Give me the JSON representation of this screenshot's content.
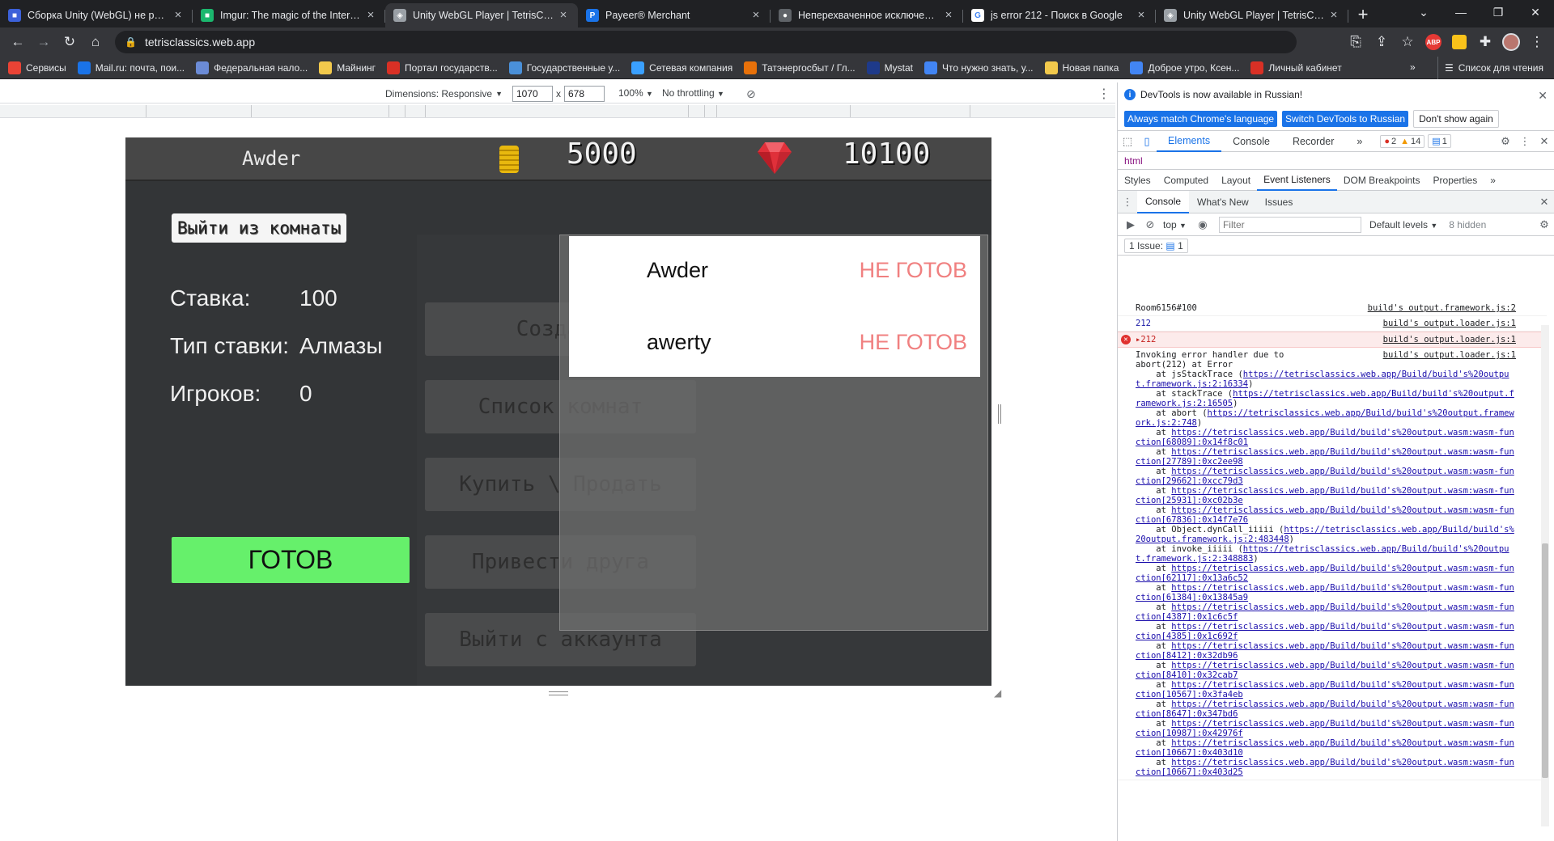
{
  "browser": {
    "tabs": [
      {
        "title": "Сборка Unity (WebGL) не рабо…",
        "color": "#3c61d9",
        "active": false,
        "glyph": "■"
      },
      {
        "title": "Imgur: The magic of the Internet",
        "color": "#1bb76e",
        "active": false,
        "glyph": "■"
      },
      {
        "title": "Unity WebGL Player | TetrisClass",
        "color": "#9aa0a6",
        "active": true,
        "glyph": "◈"
      },
      {
        "title": "Payeer® Merchant",
        "color": "#1a73e8",
        "active": false,
        "glyph": "P"
      },
      {
        "title": "Неперехваченное исключение",
        "color": "#5f6368",
        "active": false,
        "glyph": "●"
      },
      {
        "title": "js error 212 - Поиск в Google",
        "color": "#ffffff",
        "active": false,
        "glyph": "G"
      },
      {
        "title": "Unity WebGL Player | TetrisClass",
        "color": "#9aa0a6",
        "active": false,
        "glyph": "◈"
      }
    ],
    "url": "tetrisclassics.web.app",
    "bookmarks": [
      {
        "label": "Сервисы",
        "color": "#ea4335"
      },
      {
        "label": "Mail.ru: почта, пои...",
        "color": "#1a73e8"
      },
      {
        "label": "Федеральная нало...",
        "color": "#6b8bd6"
      },
      {
        "label": "Майнинг",
        "color": "#f2c94c"
      },
      {
        "label": "Портал государств...",
        "color": "#d93025"
      },
      {
        "label": "Государственные у...",
        "color": "#4a90d9"
      },
      {
        "label": "Сетевая компания",
        "color": "#3aa0ff"
      },
      {
        "label": "Татэнергосбыт / Гл...",
        "color": "#e8710a"
      },
      {
        "label": "Mystat",
        "color": "#1e3a8a"
      },
      {
        "label": "Что нужно знать, у...",
        "color": "#4285f4"
      },
      {
        "label": "Новая папка",
        "color": "#f2c94c"
      },
      {
        "label": "Доброе утро, Ксен...",
        "color": "#4285f4"
      },
      {
        "label": "Личный кабинет",
        "color": "#d93025"
      }
    ],
    "bookmarks_more": "»",
    "reading_list": "Список для чтения"
  },
  "device_toolbar": {
    "dimensions_label": "Dimensions: Responsive",
    "width": "1070",
    "height": "678",
    "times": "x",
    "zoom": "100%",
    "throttling": "No throttling"
  },
  "game": {
    "username": "Awder",
    "coins": "5000",
    "gems": "10100",
    "exit_room": "Выйти из комнаты",
    "bet_label": "Ставка:",
    "bet_value": "100",
    "bet_type_label": "Тип ставки:",
    "bet_type_value": "Алмазы",
    "players_label": "Игроков:",
    "players_value": "0",
    "ready": "ГОТОВ",
    "menu": [
      "Создать",
      "Список комнат",
      "Купить \\ Продать",
      "Привести друга",
      "Выйти с аккаунта"
    ],
    "players_list": [
      {
        "name": "Awder",
        "status": "НЕ ГОТОВ"
      },
      {
        "name": "awerty",
        "status": "НЕ ГОТОВ"
      }
    ],
    "colors": {
      "ready_bg": "#66f06b",
      "status_red": "#f08080",
      "hud_bg": "#474747",
      "panel_bg": "#333537"
    }
  },
  "devtools": {
    "info": "DevTools is now available in Russian!",
    "lang_match": "Always match Chrome's language",
    "lang_switch": "Switch DevTools to Russian",
    "dont_show": "Don't show again",
    "tabs": [
      "Elements",
      "Console",
      "Recorder",
      "»"
    ],
    "counts": {
      "errors": "2",
      "warnings": "14",
      "messages": "1"
    },
    "crumb": "html",
    "subtabs": [
      "Styles",
      "Computed",
      "Layout",
      "Event Listeners",
      "DOM Breakpoints",
      "Properties",
      "»"
    ],
    "drawer_tabs": [
      "Console",
      "What's New",
      "Issues"
    ],
    "context": "top",
    "filter_placeholder": "Filter",
    "levels": "Default levels",
    "hidden": "8 hidden",
    "issues_label": "1 Issue:",
    "issues_count": "1",
    "console": [
      {
        "text": "Room6156#100",
        "src": "build's output.framework.js:2"
      },
      {
        "text": "212",
        "src": "build's output.loader.js:1"
      },
      {
        "text": "▸212",
        "src": "build's output.loader.js:1",
        "error": true
      },
      {
        "text": "Invoking error handler due to\nabort(212) at Error",
        "src": "build's output.loader.js:1"
      }
    ],
    "trace": [
      {
        "pre": "    at jsStackTrace (",
        "url": "https://tetrisclassics.web.app/Build/build's%20output.framework.js:2:16334",
        "post": ")"
      },
      {
        "pre": "    at stackTrace (",
        "url": "https://tetrisclassics.web.app/Build/build's%20output.framework.js:2:16505",
        "post": ")"
      },
      {
        "pre": "    at abort (",
        "url": "https://tetrisclassics.web.app/Build/build's%20output.framework.js:2:748",
        "post": ")"
      },
      {
        "pre": "    at ",
        "url": "https://tetrisclassics.web.app/Build/build's%20output.wasm:wasm-function[68089]:0x14f8c01",
        "post": ""
      },
      {
        "pre": "    at ",
        "url": "https://tetrisclassics.web.app/Build/build's%20output.wasm:wasm-function[27789]:0xc2ee98",
        "post": ""
      },
      {
        "pre": "    at ",
        "url": "https://tetrisclassics.web.app/Build/build's%20output.wasm:wasm-function[29662]:0xcc79d3",
        "post": ""
      },
      {
        "pre": "    at ",
        "url": "https://tetrisclassics.web.app/Build/build's%20output.wasm:wasm-function[25931]:0xc02b3e",
        "post": ""
      },
      {
        "pre": "    at ",
        "url": "https://tetrisclassics.web.app/Build/build's%20output.wasm:wasm-function[67836]:0x14f7e76",
        "post": ""
      },
      {
        "pre": "    at Object.dynCall_iiiii (",
        "url": "https://tetrisclassics.web.app/Build/build's%20output.framework.js:2:483448",
        "post": ")"
      },
      {
        "pre": "    at invoke_iiiii (",
        "url": "https://tetrisclassics.web.app/Build/build's%20output.framework.js:2:348883",
        "post": ")"
      },
      {
        "pre": "    at ",
        "url": "https://tetrisclassics.web.app/Build/build's%20output.wasm:wasm-function[62117]:0x13a6c52",
        "post": ""
      },
      {
        "pre": "    at ",
        "url": "https://tetrisclassics.web.app/Build/build's%20output.wasm:wasm-function[61384]:0x13845a9",
        "post": ""
      },
      {
        "pre": "    at ",
        "url": "https://tetrisclassics.web.app/Build/build's%20output.wasm:wasm-function[4387]:0x1c6c5f",
        "post": ""
      },
      {
        "pre": "    at ",
        "url": "https://tetrisclassics.web.app/Build/build's%20output.wasm:wasm-function[4385]:0x1c692f",
        "post": ""
      },
      {
        "pre": "    at ",
        "url": "https://tetrisclassics.web.app/Build/build's%20output.wasm:wasm-function[8412]:0x32db96",
        "post": ""
      },
      {
        "pre": "    at ",
        "url": "https://tetrisclassics.web.app/Build/build's%20output.wasm:wasm-function[8410]:0x32cab7",
        "post": ""
      },
      {
        "pre": "    at ",
        "url": "https://tetrisclassics.web.app/Build/build's%20output.wasm:wasm-function[10567]:0x3fa4eb",
        "post": ""
      },
      {
        "pre": "    at ",
        "url": "https://tetrisclassics.web.app/Build/build's%20output.wasm:wasm-function[8647]:0x347bd6",
        "post": ""
      },
      {
        "pre": "    at ",
        "url": "https://tetrisclassics.web.app/Build/build's%20output.wasm:wasm-function[10987]:0x42976f",
        "post": ""
      },
      {
        "pre": "    at ",
        "url": "https://tetrisclassics.web.app/Build/build's%20output.wasm:wasm-function[10667]:0x403d10",
        "post": ""
      },
      {
        "pre": "    at ",
        "url": "https://tetrisclassics.web.app/Build/build's%20output.wasm:wasm-function[10667]:0x403d25",
        "post": ""
      }
    ]
  }
}
